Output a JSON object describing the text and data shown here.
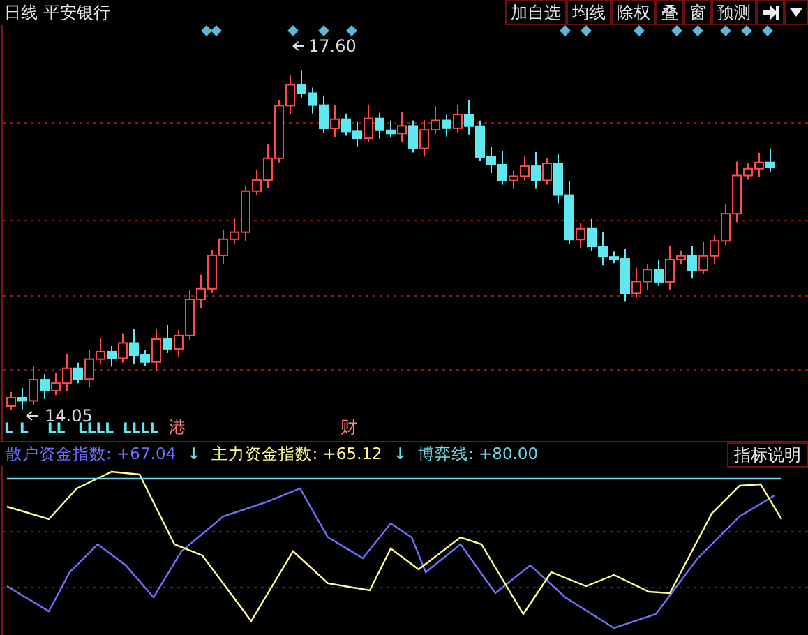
{
  "header": {
    "period": "日线",
    "stock": "平安银行"
  },
  "toolbar": [
    {
      "label": "加自选"
    },
    {
      "label": "均线"
    },
    {
      "label": "除权"
    },
    {
      "label": "叠"
    },
    {
      "label": "窗"
    },
    {
      "label": "预测"
    }
  ],
  "price_chart": {
    "high_label": "17.60",
    "low_label": "14.05",
    "signals": [
      "L",
      "L",
      "LL",
      "LLLL",
      "LLLL"
    ],
    "events": [
      "港",
      "财"
    ]
  },
  "indicator": {
    "legend": [
      {
        "label": "散户资金指数: +67.04",
        "arrow": "↓",
        "color": "#7070ff"
      },
      {
        "label": "主力资金指数: +65.12",
        "arrow": "↓",
        "color": "#ffff90"
      },
      {
        "label": "博弈线: +80.00",
        "color": "#70d8e8"
      }
    ],
    "help_button": "指标说明"
  }
}
